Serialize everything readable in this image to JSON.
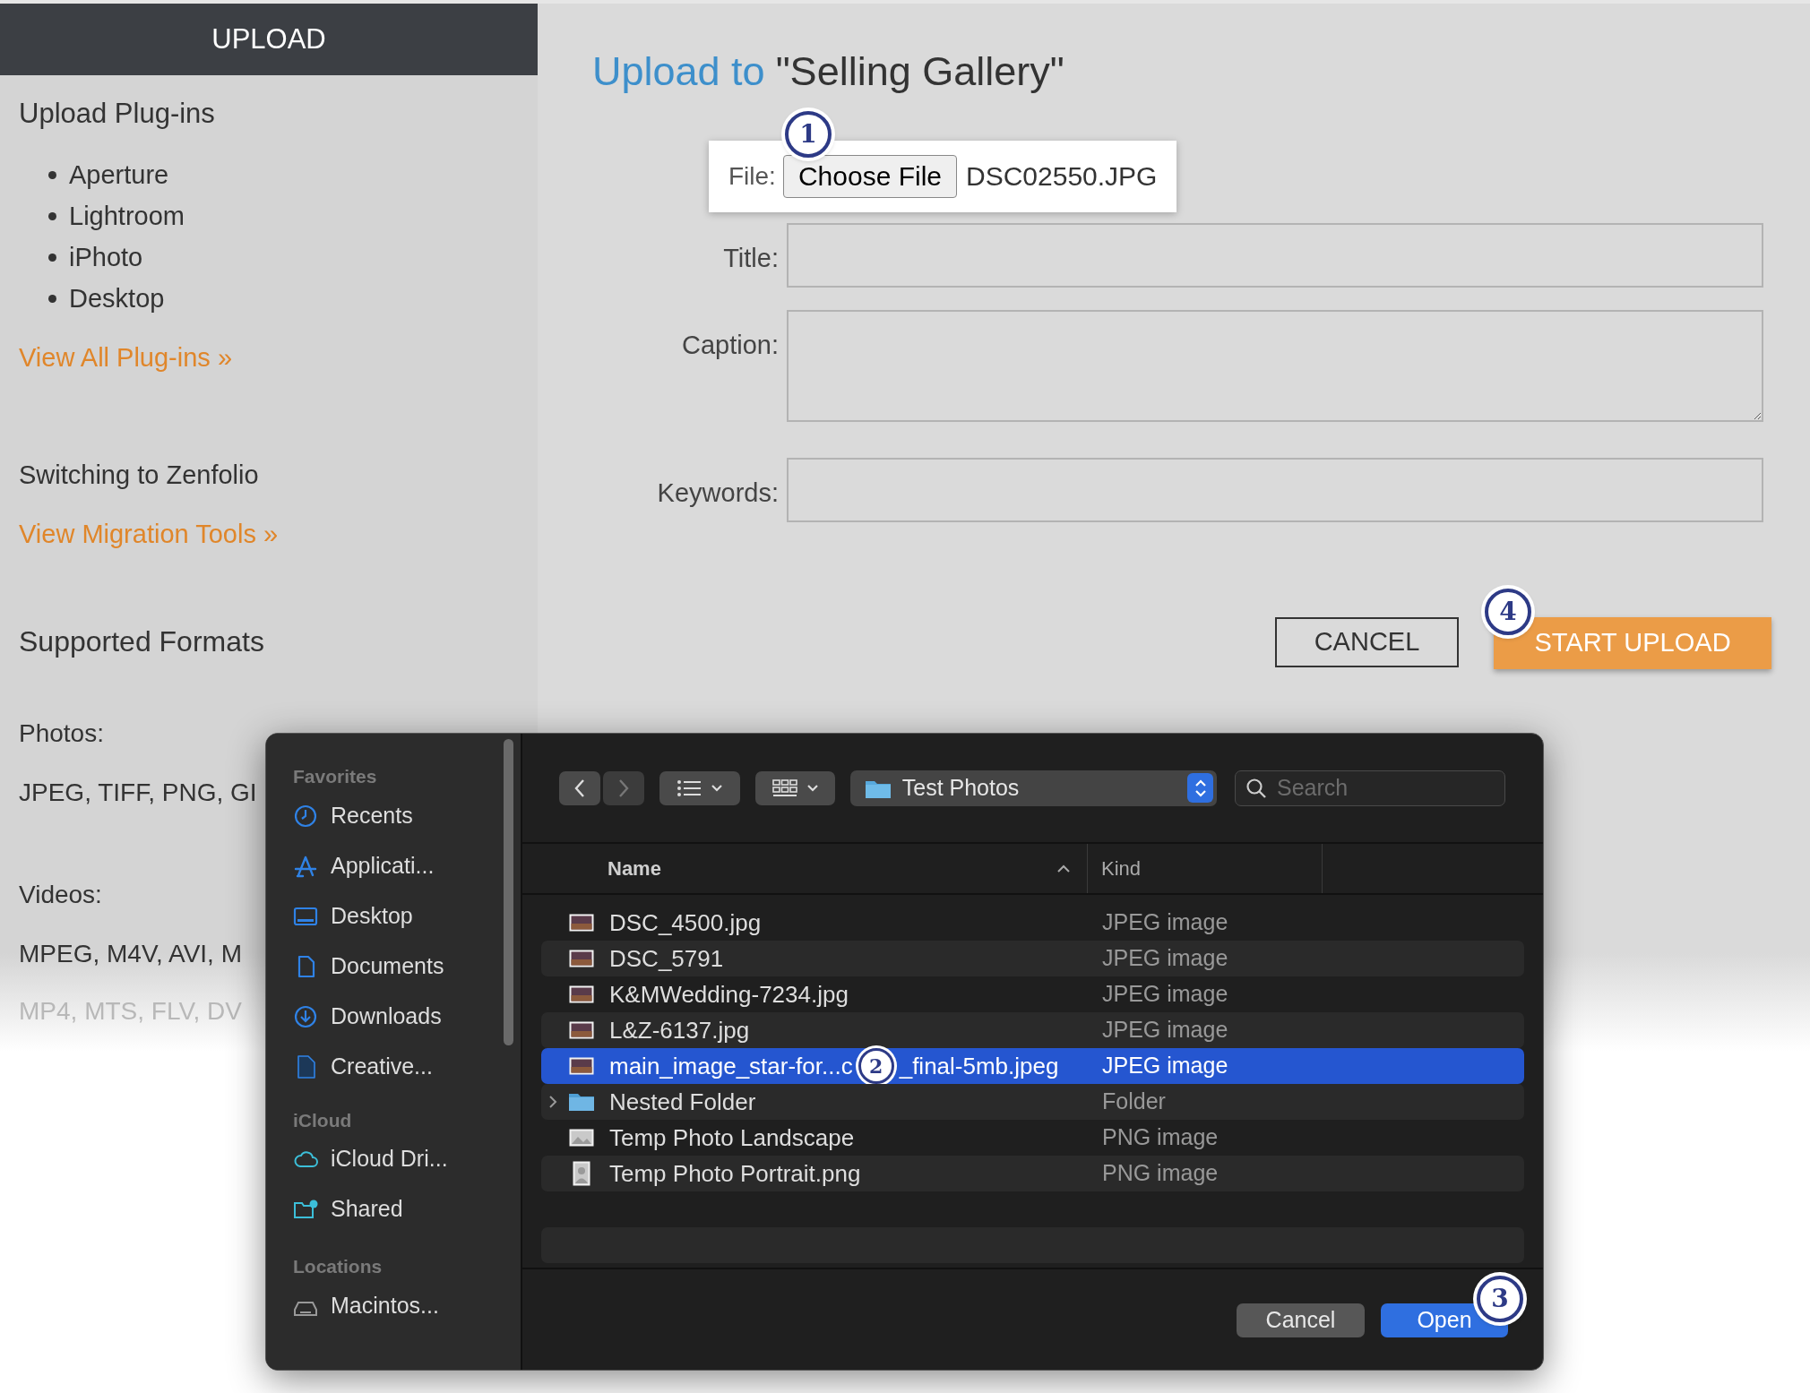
{
  "sidebar": {
    "title": "UPLOAD",
    "plugins_heading": "Upload Plug-ins",
    "plugins": [
      "Aperture",
      "Lightroom",
      "iPhoto",
      "Desktop"
    ],
    "plugins_link": "View All Plug-ins »",
    "switching_heading": "Switching to Zenfolio",
    "migration_link": "View Migration Tools »",
    "formats_heading": "Supported Formats",
    "photos_label": "Photos:",
    "photo_formats": "JPEG, TIFF, PNG, GI",
    "videos_label": "Videos:",
    "video_formats": [
      "MPEG, M4V, AVI, M",
      "MP4, MTS, FLV, DV"
    ]
  },
  "upload_form": {
    "title_prefix": "Upload to",
    "title_gallery": "\"Selling Gallery\"",
    "file_label": "File:",
    "choose_button": "Choose File",
    "file_name": "DSC02550.JPG",
    "fields": [
      {
        "label": "Title:",
        "kind": "line"
      },
      {
        "label": "Caption:",
        "kind": "area"
      },
      {
        "label": "Keywords:",
        "kind": "line"
      }
    ],
    "cancel_button": "CANCEL",
    "start_button": "START UPLOAD"
  },
  "file_dialog": {
    "sidebar": [
      {
        "heading": "Favorites",
        "items": [
          "Recents",
          "Applicati...",
          "Desktop",
          "Documents",
          "Downloads",
          "Creative..."
        ]
      },
      {
        "heading": "iCloud",
        "items": [
          "iCloud Dri...",
          "Shared"
        ]
      },
      {
        "heading": "Locations",
        "items": [
          "Macintos..."
        ]
      }
    ],
    "path": "Test Photos",
    "search_placeholder": "Search",
    "columns": [
      "Name",
      "Kind"
    ],
    "files": [
      {
        "name": "DSC_4500.jpg",
        "file_kind": "JPEG image",
        "kind": "photo",
        "selected": false
      },
      {
        "name": "DSC_5791",
        "file_kind": "JPEG image",
        "kind": "photo",
        "selected": false
      },
      {
        "name": "K&MWedding-7234.jpg",
        "file_kind": "JPEG image",
        "kind": "photo",
        "selected": false
      },
      {
        "name": "L&Z-6137.jpg",
        "file_kind": "JPEG image",
        "kind": "photo",
        "selected": false
      },
      {
        "name": "main_image_star-for...c",
        "name_end": "_final-5mb.jpeg",
        "file_kind": "JPEG image",
        "kind": "photo",
        "selected": true
      },
      {
        "name": "Nested Folder",
        "file_kind": "Folder",
        "kind": "folder",
        "selected": false
      },
      {
        "name": "Temp Photo Landscape",
        "file_kind": "PNG image",
        "kind": "landscape",
        "selected": false
      },
      {
        "name": "Temp Photo Portrait.png",
        "file_kind": "PNG image",
        "kind": "portrait",
        "selected": false
      }
    ],
    "cancel_button": "Cancel",
    "open_button": "Open"
  },
  "callouts": [
    "1",
    "2",
    "3",
    "4"
  ]
}
